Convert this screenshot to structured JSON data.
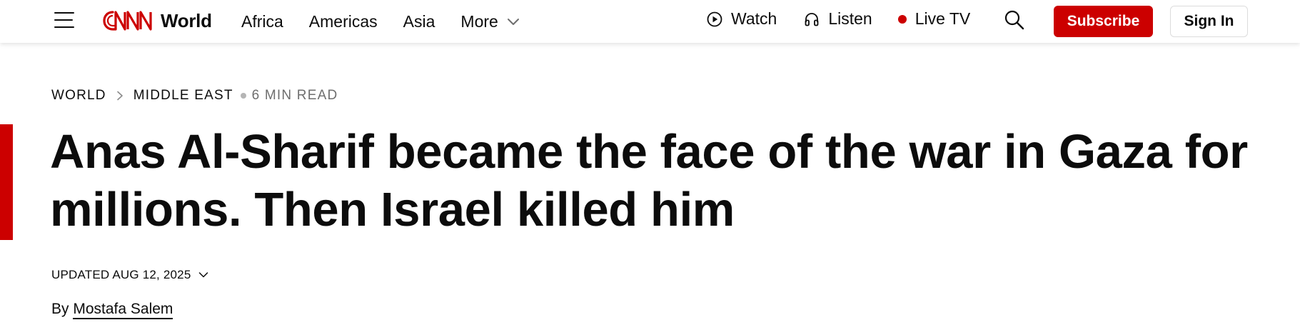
{
  "header": {
    "brand_logo_text": "CNN",
    "edition_label": "World",
    "nav_items": [
      {
        "label": "Africa"
      },
      {
        "label": "Americas"
      },
      {
        "label": "Asia"
      },
      {
        "label": "More"
      }
    ],
    "watch_label": "Watch",
    "listen_label": "Listen",
    "live_tv_label": "Live TV",
    "subscribe_label": "Subscribe",
    "sign_in_label": "Sign In"
  },
  "article": {
    "breadcrumb": [
      "WORLD",
      "MIDDLE EAST"
    ],
    "read_time": "6 MIN READ",
    "headline": "Anas Al-Sharif became the face of the war in Gaza for millions. Then Israel killed him",
    "updated": "UPDATED AUG 12, 2025",
    "byline_prefix": "By",
    "author": "Mostafa Salem"
  },
  "colors": {
    "brand_red": "#cc0000",
    "text": "#0c0c0c",
    "muted": "#6e6e6e"
  },
  "icons": [
    "menu-icon",
    "cnn-logo",
    "chevron-down-icon",
    "play-circle-icon",
    "headphones-icon",
    "live-dot-icon",
    "search-icon",
    "chevron-right-icon"
  ]
}
